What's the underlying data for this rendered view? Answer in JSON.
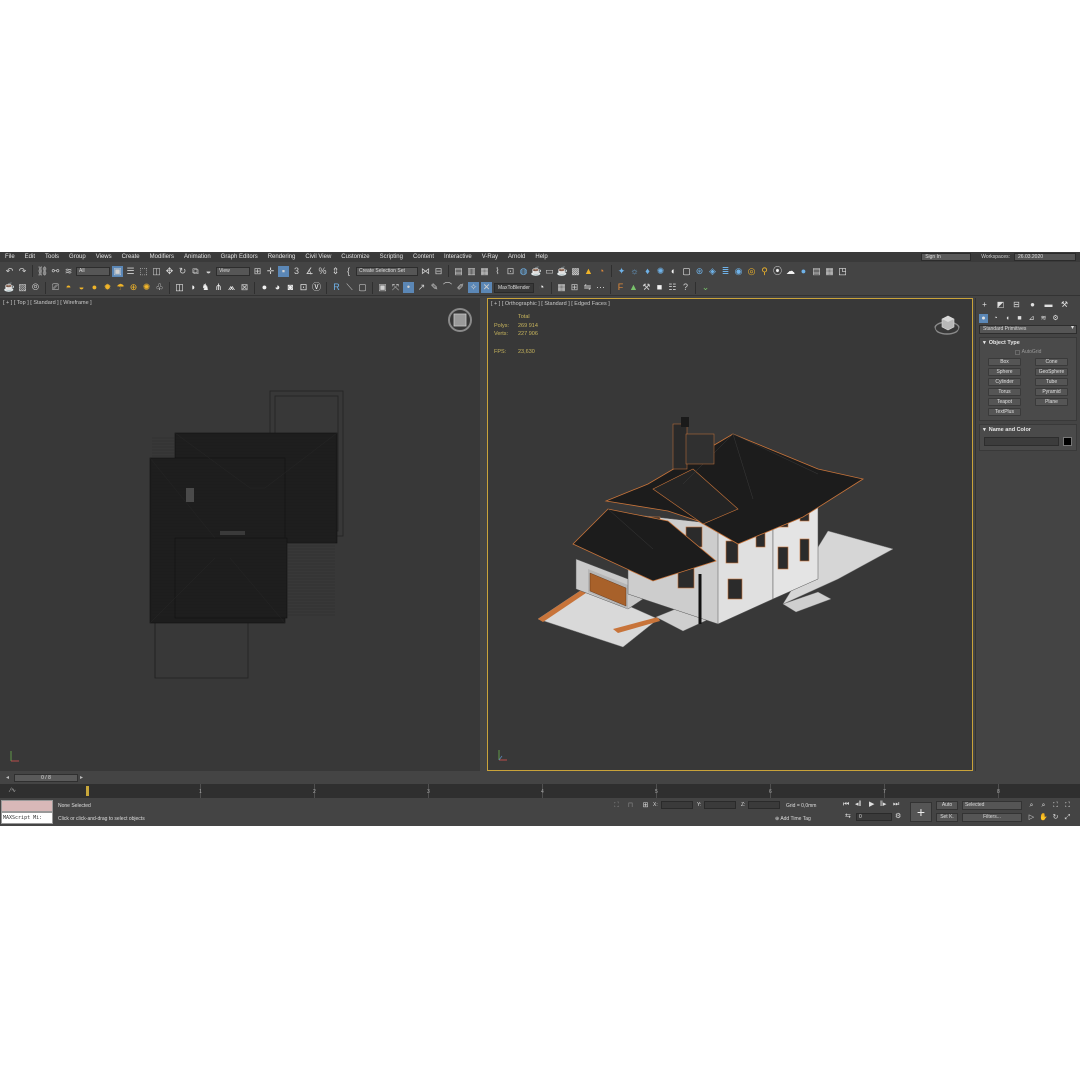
{
  "menu": [
    "File",
    "Edit",
    "Tools",
    "Group",
    "Views",
    "Create",
    "Modifiers",
    "Animation",
    "Graph Editors",
    "Rendering",
    "Civil View",
    "Customize",
    "Scripting",
    "Content",
    "Interactive",
    "V-Ray",
    "Arnold",
    "Help"
  ],
  "account": {
    "signin": "Sign In",
    "workspaces_label": "Workspaces:",
    "workspace_value": "26.03.2020"
  },
  "toolbar": {
    "filter_value": "All",
    "refcoord_value": "View",
    "selection_set_placeholder": "Create Selection Set",
    "plugin_button": "MaxToBlender"
  },
  "viewports": {
    "left_label": "[ + ] [ Top ] [ Standard ] [ Wireframe ]",
    "right_label": "[ + ] [ Orthographic ] [ Standard ] [ Edged Faces ]",
    "stats": {
      "total_label": "Total",
      "polys_label": "Polys:",
      "polys_value": "269 914",
      "verts_label": "Verts:",
      "verts_value": "227 906",
      "fps_label": "FPS:",
      "fps_value": "23,630"
    }
  },
  "command_panel": {
    "category": "Standard Primitives",
    "object_type_title": "Object Type",
    "autogrid": "AutoGrid",
    "objects": [
      "Box",
      "Cone",
      "Sphere",
      "GeoSphere",
      "Cylinder",
      "Tube",
      "Torus",
      "Pyramid",
      "Teapot",
      "Plane",
      "TextPlus"
    ],
    "name_color_title": "Name and Color"
  },
  "timeline": {
    "slider": "0 / 8",
    "ticks": [
      "1",
      "2",
      "3",
      "4",
      "5",
      "6",
      "7",
      "8"
    ]
  },
  "status": {
    "maxscript": "MAXScript Mi:",
    "selection": "None Selected",
    "prompt": "Click or click-and-drag to select objects",
    "x_label": "X:",
    "y_label": "Y:",
    "z_label": "Z:",
    "grid": "Grid = 0,0mm",
    "add_time_tag": "Add Time Tag",
    "frame": "0",
    "auto_key": "Auto",
    "set_key": "Set K.",
    "selected": "Selected",
    "filters": "Filters..."
  },
  "colors": {
    "accent": "#5b87b6",
    "viewport_border": "#c9a33a",
    "stats_text": "#c9b65d",
    "roof": "#1c1c1c",
    "trim": "#c8743a"
  }
}
